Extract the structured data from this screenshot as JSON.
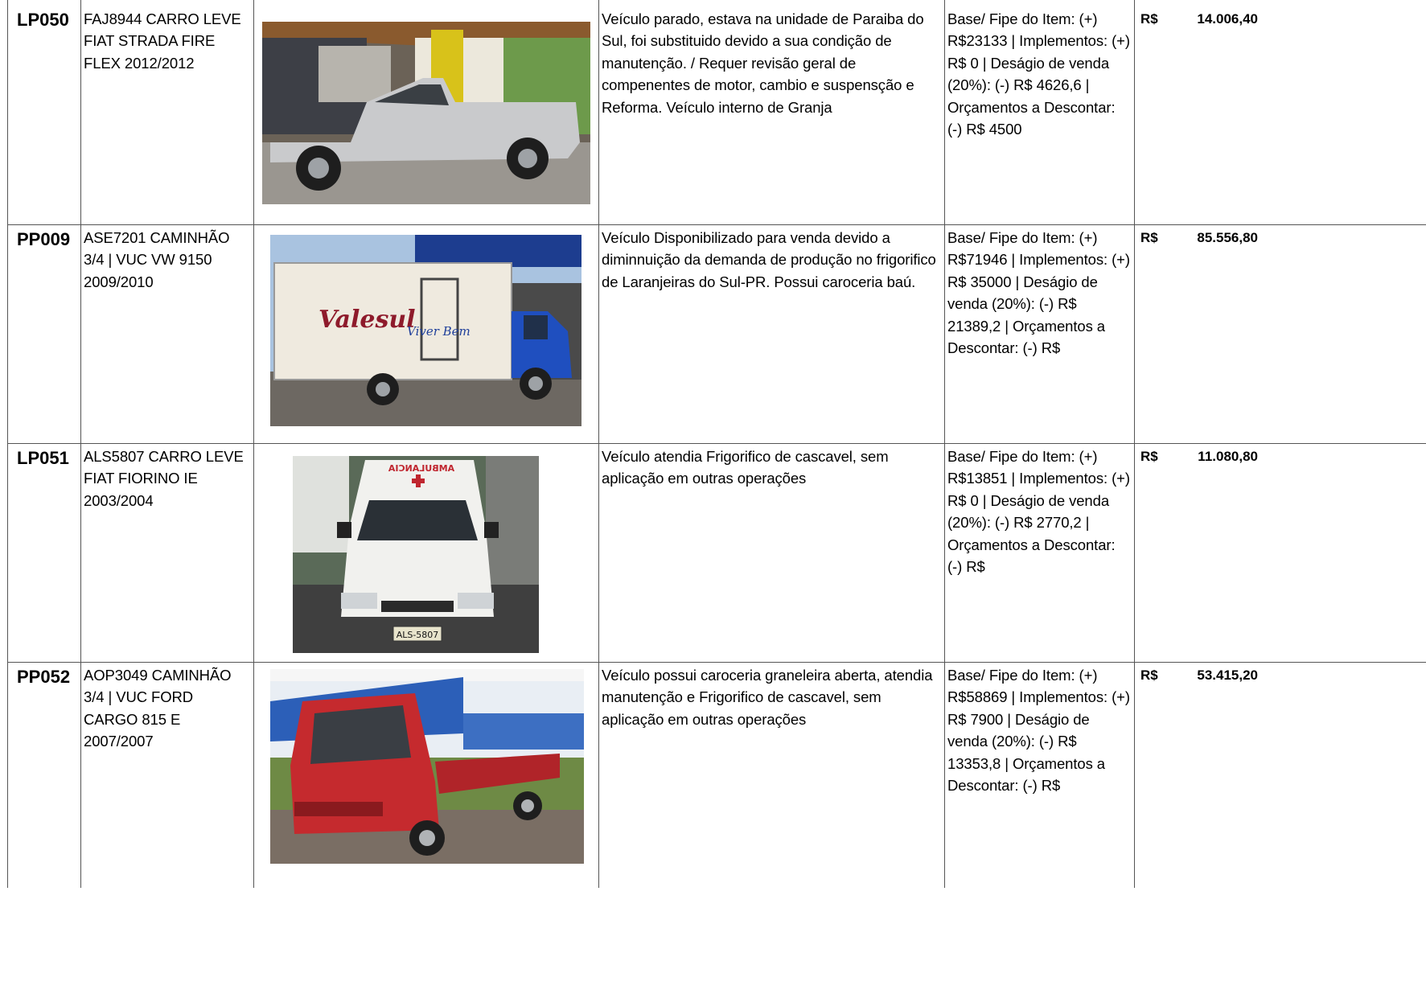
{
  "rows": [
    {
      "code": "LP050",
      "vehicle": "FAJ8944 CARRO LEVE FIAT STRADA FIRE FLEX 2012/2012",
      "description": "Veículo parado, estava na unidade de Paraiba do Sul, foi substituido devido a sua condição de manutenção. /  Requer revisão geral de compenentes de motor, cambio e suspensção e Reforma. Veículo interno de Granja",
      "pricing": "Base/ Fipe do Item: (+) R$23133 | Implementos: (+) R$ 0 | Deságio de venda (20%): (-) R$ 4626,6 | Orçamentos a Descontar: (-) R$ 4500",
      "currency": "R$",
      "value": "14.006,40",
      "photo_icon": "silver-pickup-truck-photo"
    },
    {
      "code": "PP009",
      "vehicle": "ASE7201 CAMINHÃO 3/4 | VUC VW 9150 2009/2010",
      "description": "Veículo Disponibilizado para venda devido a diminnuição da demanda de produção no frigorifico de Laranjeiras do Sul-PR. Possui caroceria baú.",
      "pricing": "Base/ Fipe do Item: (+) R$71946 | Implementos: (+) R$ 35000 | Deságio de venda (20%): (-) R$ 21389,2 | Orçamentos a Descontar: (-) R$",
      "currency": "R$",
      "value": "85.556,80",
      "photo_icon": "blue-box-truck-photo",
      "photo_text": {
        "brand": "Valesul",
        "slogan": "Viver Bem"
      }
    },
    {
      "code": "LP051",
      "vehicle": "ALS5807 CARRO LEVE FIAT FIORINO IE 2003/2004",
      "description": "Veículo atendia Frigorifico de cascavel, sem aplicação em outras operações",
      "pricing": "Base/ Fipe do Item: (+) R$13851 | Implementos: (+) R$ 0 | Deságio de venda (20%): (-) R$ 2770,2 | Orçamentos a Descontar: (-) R$",
      "currency": "R$",
      "value": "11.080,80",
      "photo_icon": "white-ambulance-van-photo",
      "photo_text": {
        "roof_sign": "AMBULANCIA",
        "plate": "ALS-5807"
      }
    },
    {
      "code": "PP052",
      "vehicle": "AOP3049 CAMINHÃO 3/4 | VUC FORD CARGO 815 E 2007/2007",
      "description": "Veículo possui caroceria graneleira aberta, atendia manutenção e Frigorifico de cascavel, sem aplicação em outras operações",
      "pricing": "Base/ Fipe do Item: (+) R$58869 | Implementos: (+) R$ 7900 | Deságio de venda (20%): (-) R$ 13353,8 | Orçamentos a Descontar: (-) R$",
      "currency": "R$",
      "value": "53.415,20",
      "photo_icon": "red-flatbed-truck-photo"
    }
  ]
}
